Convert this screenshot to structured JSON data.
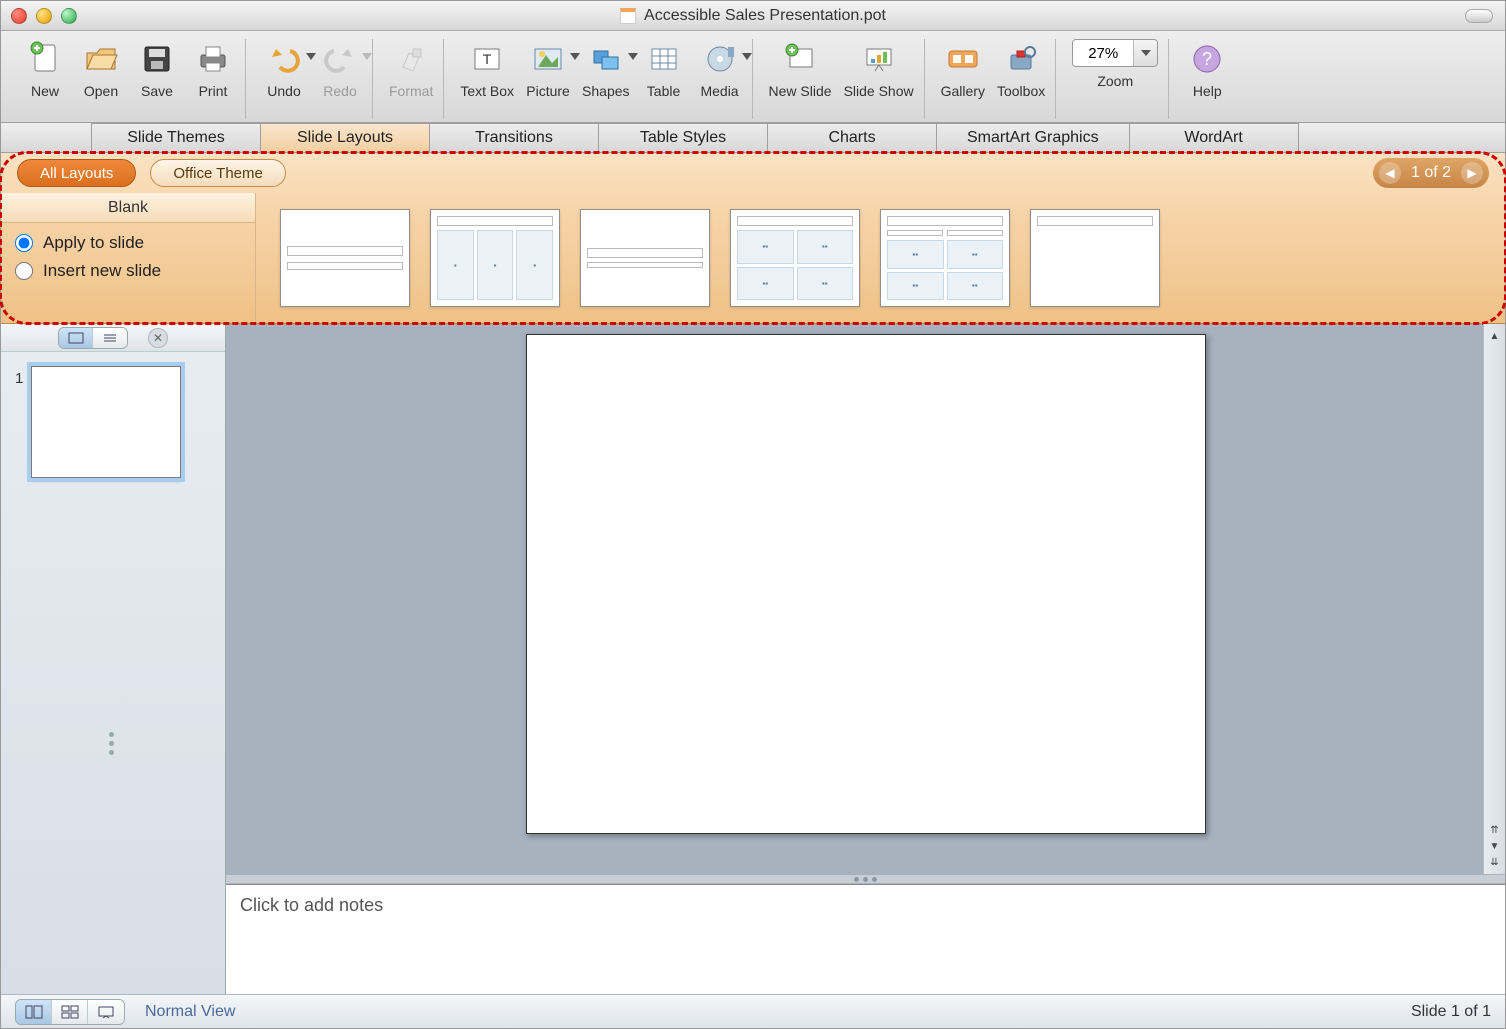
{
  "window": {
    "title": "Accessible Sales Presentation.pot"
  },
  "toolbar": {
    "items": [
      {
        "label": "New"
      },
      {
        "label": "Open"
      },
      {
        "label": "Save"
      },
      {
        "label": "Print"
      },
      {
        "label": "Undo"
      },
      {
        "label": "Redo"
      },
      {
        "label": "Format"
      },
      {
        "label": "Text Box"
      },
      {
        "label": "Picture"
      },
      {
        "label": "Shapes"
      },
      {
        "label": "Table"
      },
      {
        "label": "Media"
      },
      {
        "label": "New Slide"
      },
      {
        "label": "Slide Show"
      },
      {
        "label": "Gallery"
      },
      {
        "label": "Toolbox"
      },
      {
        "label": "Zoom"
      },
      {
        "label": "Help"
      }
    ],
    "zoom_value": "27%"
  },
  "tabs": {
    "items": [
      "Slide Themes",
      "Slide Layouts",
      "Transitions",
      "Table Styles",
      "Charts",
      "SmartArt Graphics",
      "WordArt"
    ],
    "active_index": 1
  },
  "gallery": {
    "filters": {
      "all": "All Layouts",
      "theme": "Office Theme"
    },
    "side_header": "Blank",
    "radio_apply": "Apply to slide",
    "radio_insert": "Insert new slide",
    "radio_selected": "apply",
    "pager_text": "1 of 2"
  },
  "slidenav": {
    "slides": [
      {
        "num": "1"
      }
    ]
  },
  "notes": {
    "placeholder": "Click to add notes"
  },
  "status": {
    "view_label": "Normal View",
    "slide_counter": "Slide 1 of 1"
  }
}
